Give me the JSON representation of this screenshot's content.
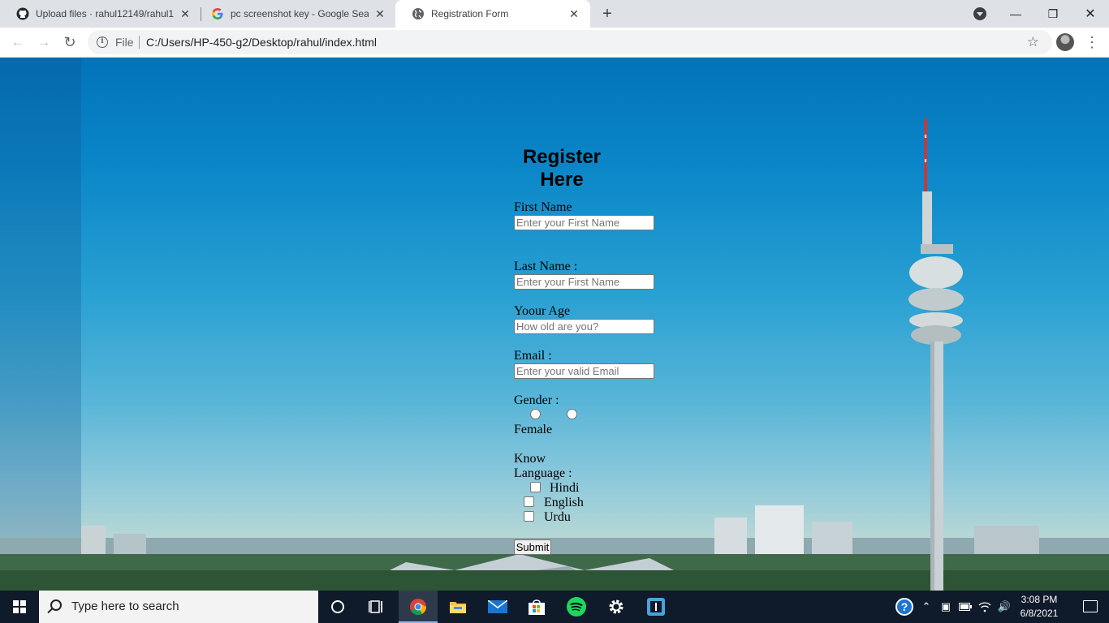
{
  "browser": {
    "tabs": [
      {
        "title": "Upload files · rahul12149/rahul12",
        "icon": "github-icon",
        "active": false
      },
      {
        "title": "pc screenshot key - Google Searc",
        "icon": "google-icon",
        "active": false
      },
      {
        "title": "Registration Form",
        "icon": "globe-icon",
        "active": true
      }
    ],
    "address": {
      "scheme_label": "File",
      "url": "C:/Users/HP-450-g2/Desktop/rahul/index.html"
    }
  },
  "form": {
    "title_line1": "Register",
    "title_line2": "Here",
    "first_name_label": "First Name",
    "first_name_placeholder": "Enter your First Name",
    "last_name_label": "Last Name :",
    "last_name_placeholder": "Enter your First Name",
    "age_label": "Yoour Age",
    "age_placeholder": "How old are you?",
    "email_label": "Email :",
    "email_placeholder": "Enter your valid Email",
    "gender_label": "Gender :",
    "gender_female_label": "Female",
    "language_label_line1": "Know",
    "language_label_line2": "Language :",
    "languages": [
      "Hindi",
      "English",
      "Urdu"
    ],
    "submit_label": "Submit"
  },
  "taskbar": {
    "search_placeholder": "Type here to search",
    "time": "3:08 PM",
    "date": "6/8/2021"
  }
}
